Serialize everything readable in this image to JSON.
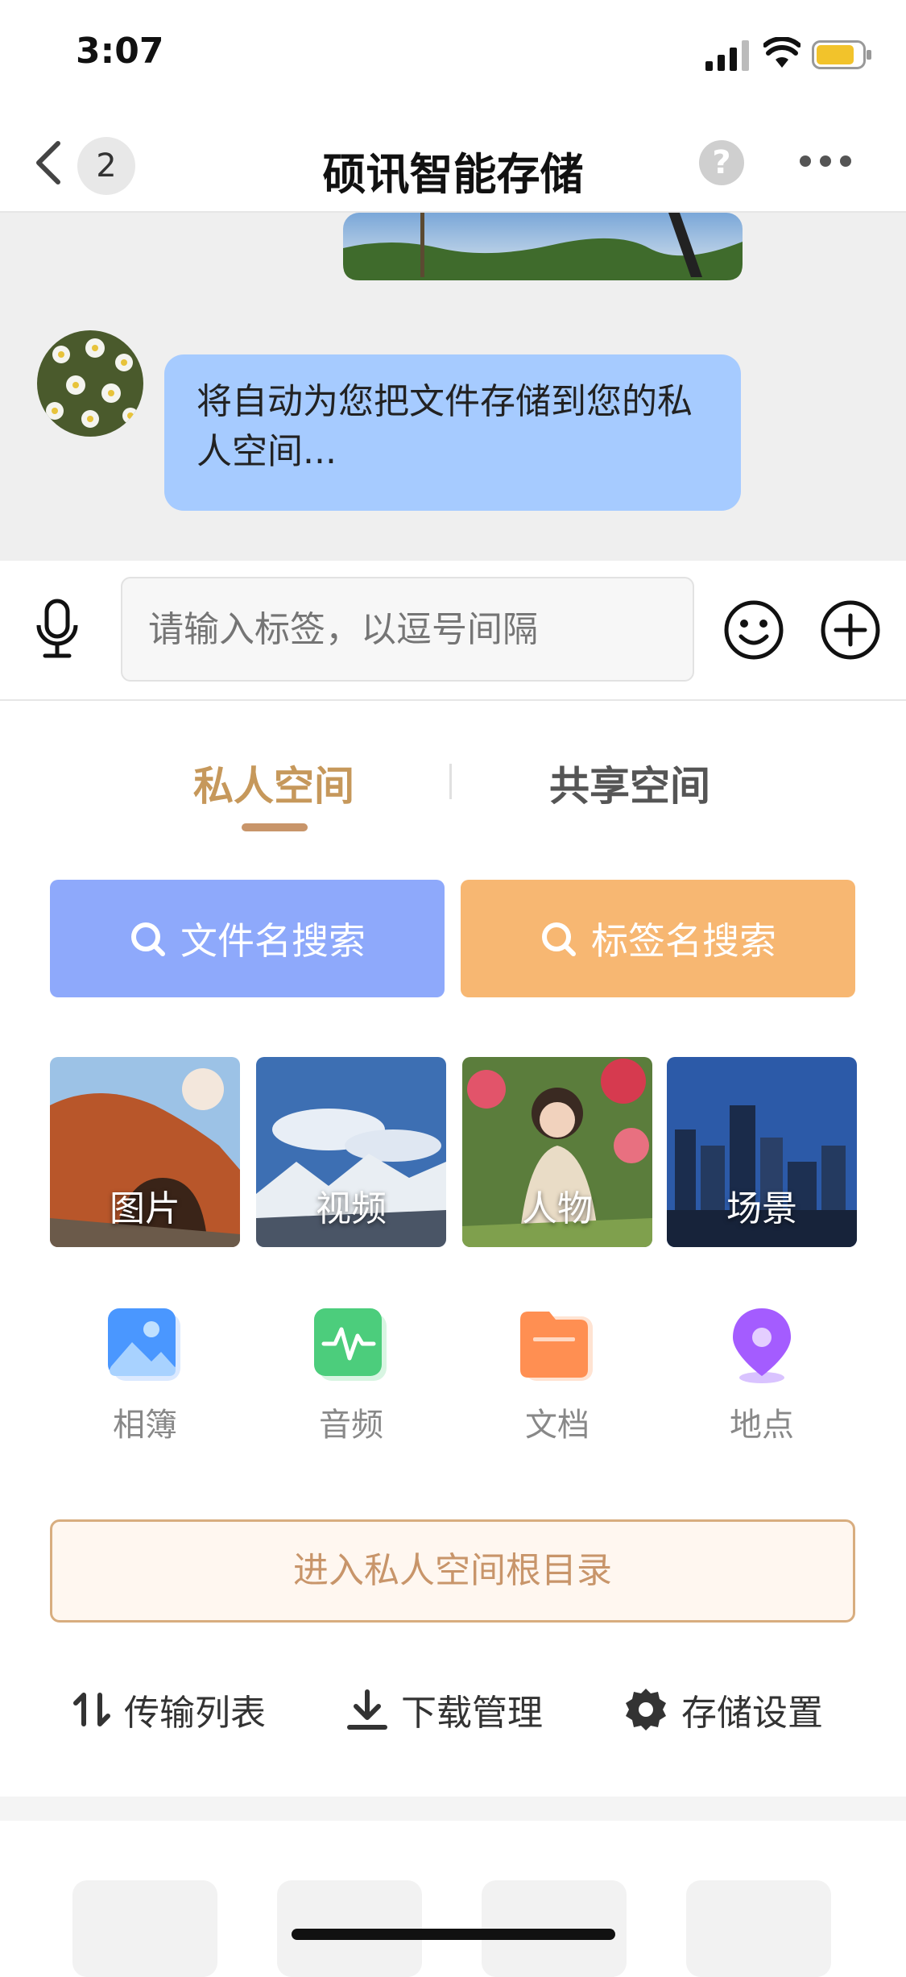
{
  "status": {
    "time": "3:07"
  },
  "nav": {
    "back_count": "2",
    "title": "硕讯智能存储",
    "help": "?"
  },
  "chat": {
    "message": "将自动为您把文件存储到您的私人空间..."
  },
  "input": {
    "placeholder": "请输入标签，以逗号间隔"
  },
  "tabs": [
    {
      "label": "私人空间",
      "active": true
    },
    {
      "label": "共享空间",
      "active": false
    }
  ],
  "search": {
    "file_label": "文件名搜索",
    "tag_label": "标签名搜索",
    "file_color": "#8ea9fb",
    "tag_color": "#f7b772"
  },
  "tiles": [
    {
      "label": "图片"
    },
    {
      "label": "视频"
    },
    {
      "label": "人物"
    },
    {
      "label": "场景"
    }
  ],
  "categories": [
    {
      "label": "相簿"
    },
    {
      "label": "音频"
    },
    {
      "label": "文档"
    },
    {
      "label": "地点"
    }
  ],
  "enter_root": "进入私人空间根目录",
  "actions": {
    "transfer": "传输列表",
    "download": "下载管理",
    "settings": "存储设置"
  },
  "colors": {
    "accent": "#c8956a",
    "chat_bg": "#efefef",
    "bubble": "#a6cbff"
  }
}
